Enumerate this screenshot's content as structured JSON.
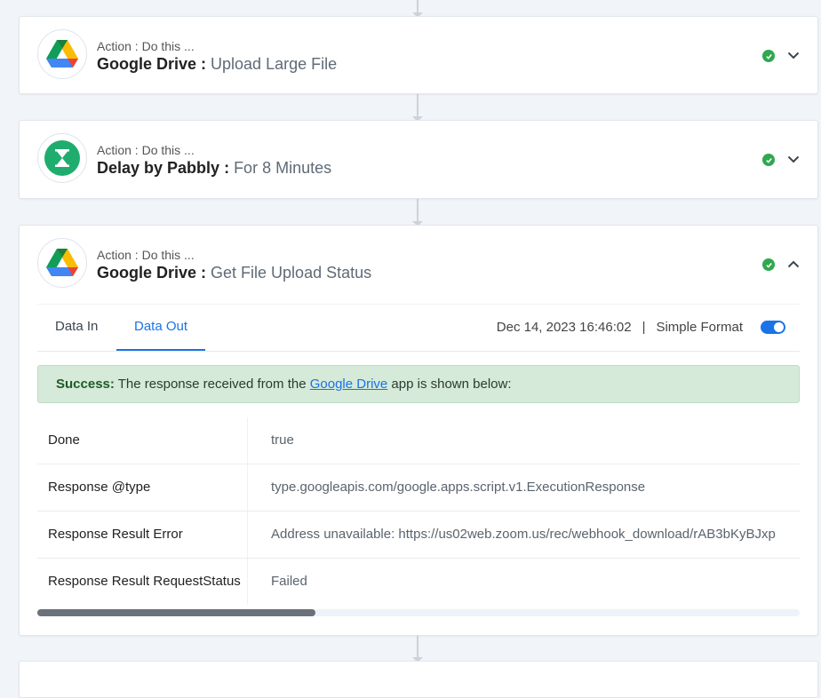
{
  "colors": {
    "accent": "#1a73e8",
    "success": "#2fa84f",
    "success_bg": "#d5ead8",
    "delay_icon": "#1fad6e"
  },
  "steps": [
    {
      "subtitle": "Action : Do this ...",
      "app": "Google Drive",
      "separator": " : ",
      "action": "Upload Large File",
      "icon": "google-drive-icon",
      "status": "success",
      "expanded": false
    },
    {
      "subtitle": "Action : Do this ...",
      "app": "Delay by Pabbly",
      "separator": " : ",
      "action": "For 8 Minutes",
      "icon": "hourglass-icon",
      "status": "success",
      "expanded": false
    },
    {
      "subtitle": "Action : Do this ...",
      "app": "Google Drive",
      "separator": " : ",
      "action": "Get File Upload Status",
      "icon": "google-drive-icon",
      "status": "success",
      "expanded": true
    }
  ],
  "detail": {
    "tabs": [
      {
        "label": "Data In"
      },
      {
        "label": "Data Out",
        "active": true
      }
    ],
    "timestamp": "Dec 14, 2023 16:46:02",
    "pipe": "|",
    "format_label": "Simple Format",
    "success_label": "Success:",
    "success_text_before": " The response received from the ",
    "success_link": "Google Drive",
    "success_text_after": " app is shown below:",
    "rows": [
      {
        "key": "Done",
        "value": "true"
      },
      {
        "key": "Response @type",
        "value": "type.googleapis.com/google.apps.script.v1.ExecutionResponse"
      },
      {
        "key": "Response Result Error",
        "value": "Address unavailable: https://us02web.zoom.us/rec/webhook_download/rAB3bKyBJxp"
      },
      {
        "key": "Response Result RequestStatus",
        "value": "Failed"
      }
    ]
  }
}
